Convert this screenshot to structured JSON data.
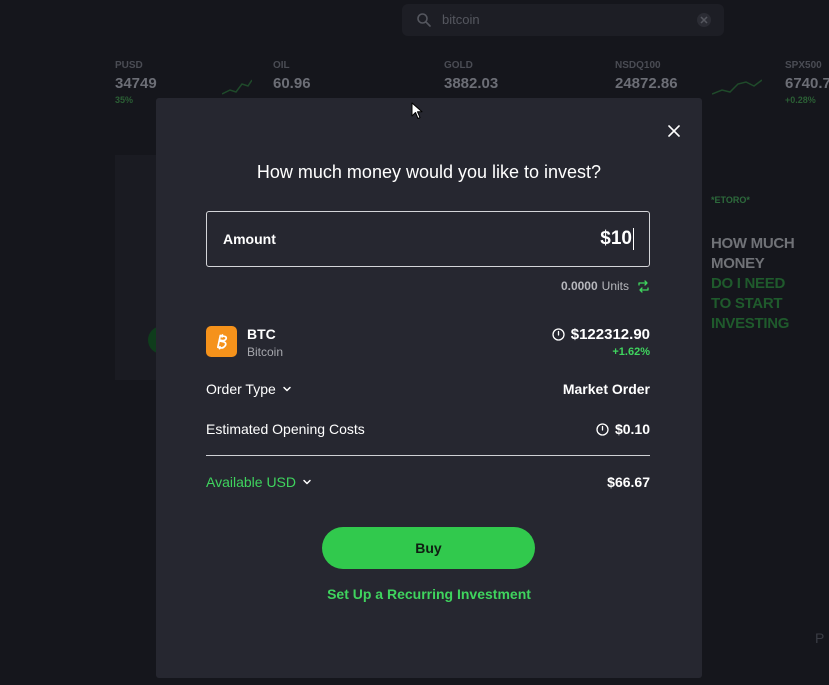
{
  "background": {
    "search": {
      "value": "bitcoin"
    },
    "tickers": [
      {
        "symbol": "PUSD",
        "value": "34749",
        "change": "35%"
      },
      {
        "symbol": "OIL",
        "value": "60.96",
        "change": ""
      },
      {
        "symbol": "GOLD",
        "value": "3882.03",
        "change": ""
      },
      {
        "symbol": "NSDQ100",
        "value": "24872.86",
        "change": ""
      },
      {
        "symbol": "SPX500",
        "value": "6740.7",
        "change": "+0.28%"
      }
    ],
    "promo": {
      "tag": "*ETORO*",
      "line1": "HOW MUCH MONEY",
      "line2": "DO I NEED",
      "line3": "TO START INVESTING"
    },
    "right_text": "P"
  },
  "modal": {
    "title": "How much money would you like to invest?",
    "amount": {
      "label": "Amount",
      "value": "$10"
    },
    "units": {
      "value": "0.0000",
      "label": "Units"
    },
    "asset": {
      "symbol": "BTC",
      "name": "Bitcoin",
      "price": "$122312.90",
      "change": "+1.62%"
    },
    "order_type": {
      "label": "Order Type",
      "value": "Market Order"
    },
    "opening_costs": {
      "label": "Estimated Opening Costs",
      "value": "$0.10"
    },
    "available": {
      "label": "Available USD",
      "value": "$66.67"
    },
    "buy_label": "Buy",
    "recurring_label": "Set Up a Recurring Investment"
  },
  "colors": {
    "accent_green": "#31c94d",
    "bitcoin_orange": "#f5921b",
    "modal_bg": "#262730",
    "page_bg": "#15161c"
  }
}
